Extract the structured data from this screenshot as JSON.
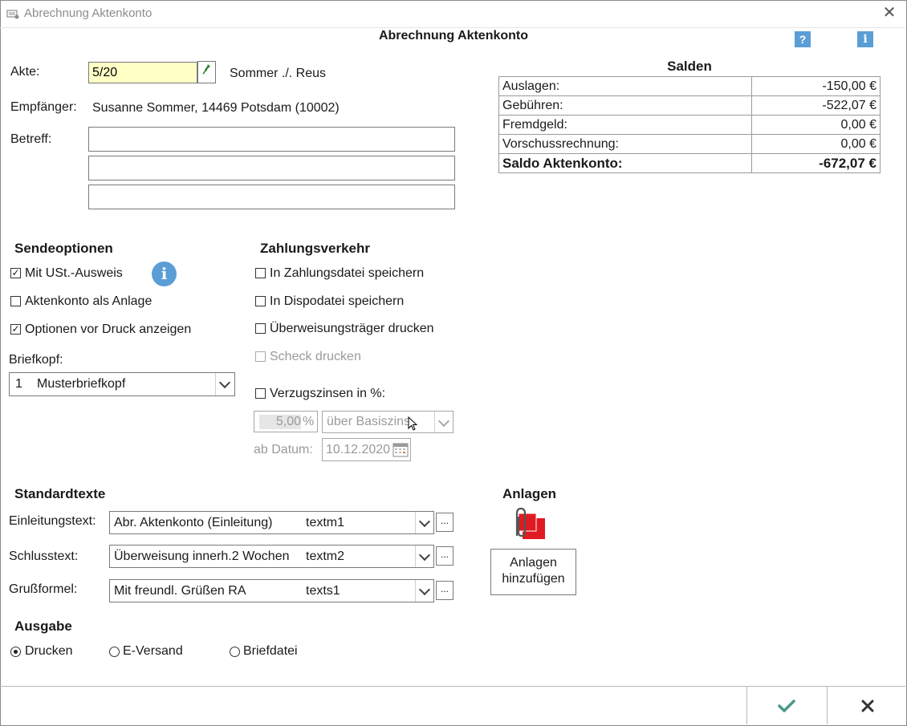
{
  "window": {
    "title": "Abrechnung Aktenkonto"
  },
  "dialog": {
    "title": "Abrechnung Aktenkonto",
    "help_q": "?",
    "help_i": "i"
  },
  "akte": {
    "label": "Akte:",
    "value": "5/20",
    "parties": "Sommer ./. Reus"
  },
  "empfaenger": {
    "label": "Empfänger:",
    "value": "Susanne Sommer, 14469 Potsdam (10002)"
  },
  "betreff": {
    "label": "Betreff:",
    "line1": "",
    "line2": "",
    "line3": ""
  },
  "salden": {
    "title": "Salden",
    "rows": [
      {
        "label": "Auslagen:",
        "value": "-150,00 €"
      },
      {
        "label": "Gebühren:",
        "value": "-522,07 €"
      },
      {
        "label": "Fremdgeld:",
        "value": "0,00 €"
      },
      {
        "label": "Vorschussrechnung:",
        "value": "0,00 €"
      }
    ],
    "total": {
      "label": "Saldo Aktenkonto:",
      "value": "-672,07 €"
    }
  },
  "sendeoptionen": {
    "title": "Sendeoptionen",
    "mit_ust": {
      "label": "Mit USt.-Ausweis",
      "checked": true
    },
    "aktenkonto_anlage": {
      "label": "Aktenkonto als Anlage",
      "checked": false
    },
    "optionen_druck": {
      "label": "Optionen vor Druck anzeigen",
      "checked": true
    },
    "briefkopf_label": "Briefkopf:",
    "briefkopf_num": "1",
    "briefkopf_value": "Musterbriefkopf"
  },
  "zahlungsverkehr": {
    "title": "Zahlungsverkehr",
    "zahlungsdatei": "In Zahlungsdatei speichern",
    "dispodatei": "In Dispodatei speichern",
    "ueberweisung": "Überweisungsträger drucken",
    "scheck": "Scheck drucken",
    "verzugszinsen": "Verzugszinsen in %:",
    "zins_value": "5,00",
    "zins_unit": "%",
    "zins_basis": "über Basiszins",
    "datum_label": "ab Datum:",
    "datum_value": "10.12.2020"
  },
  "standardtexte": {
    "title": "Standardtexte",
    "rows": [
      {
        "label": "Einleitungstext:",
        "text": "Abr. Aktenkonto (Einleitung)",
        "code": "textm1"
      },
      {
        "label": "Schlusstext:",
        "text": "Überweisung innerh.2 Wochen",
        "code": "textm2"
      },
      {
        "label": "Grußformel:",
        "text": "Mit freundl. Grüßen RA",
        "code": "texts1"
      }
    ],
    "dots": "..."
  },
  "anlagen": {
    "title": "Anlagen",
    "button_line1": "Anlagen",
    "button_line2": "hinzufügen"
  },
  "ausgabe": {
    "title": "Ausgabe",
    "options": [
      {
        "label": "Drucken",
        "selected": true
      },
      {
        "label": "E-Versand",
        "selected": false
      },
      {
        "label": "Briefdatei",
        "selected": false
      }
    ]
  },
  "colors": {
    "accent": "#5b9ed6",
    "ok_check": "#4a9a8c",
    "cancel_x": "#333333",
    "akte_bg": "#ffffc6"
  }
}
